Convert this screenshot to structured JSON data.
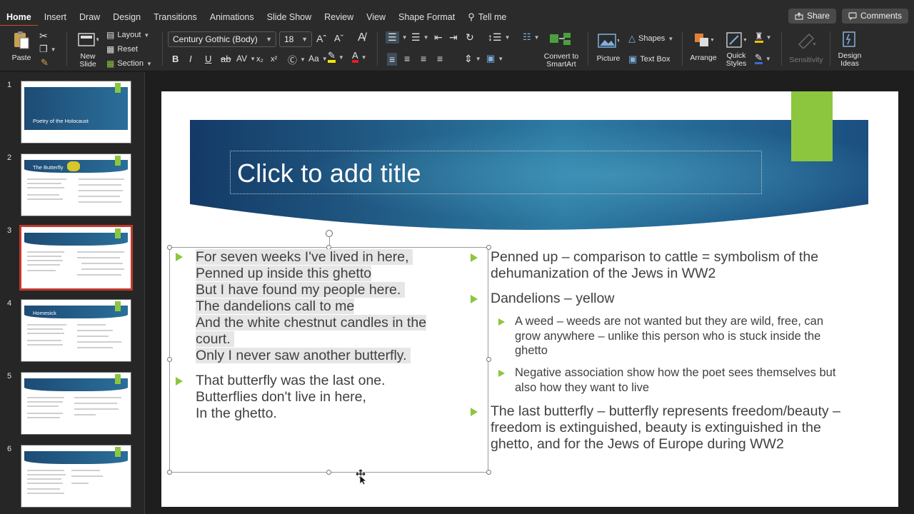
{
  "tabs": [
    "Home",
    "Insert",
    "Draw",
    "Design",
    "Transitions",
    "Animations",
    "Slide Show",
    "Review",
    "View",
    "Shape Format",
    "Tell me"
  ],
  "share_label": "Share",
  "comments_label": "Comments",
  "ribbon": {
    "paste": "Paste",
    "new_slide": [
      "New",
      "Slide"
    ],
    "layout": "Layout",
    "reset": "Reset",
    "section": "Section",
    "font_name": "Century Gothic (Body)",
    "font_size": "18",
    "convert": [
      "Convert to",
      "SmartArt"
    ],
    "picture": "Picture",
    "shapes": "Shapes",
    "text_box": "Text Box",
    "arrange": "Arrange",
    "quick_styles": [
      "Quick",
      "Styles"
    ],
    "sensitivity": "Sensitivity",
    "design_ideas": [
      "Design",
      "Ideas"
    ]
  },
  "thumbnails": [
    {
      "num": "1",
      "title": "Poetry of the Holocaust"
    },
    {
      "num": "2",
      "title": "The Butterfly"
    },
    {
      "num": "3",
      "title": ""
    },
    {
      "num": "4",
      "title": "Homesick"
    },
    {
      "num": "5",
      "title": ""
    },
    {
      "num": "6",
      "title": ""
    }
  ],
  "slide": {
    "title_placeholder": "Click to add title",
    "poem_stanza1": [
      "For seven weeks I've lived in here, ",
      "Penned up inside this ghetto",
      "But I have found my people here. ",
      "The dandelions call to me",
      "And the white chestnut candles in the",
      "court. ",
      "Only I never saw another butterfly. "
    ],
    "poem_stanza2": [
      "That butterfly was the last one.",
      "Butterflies don't live in here,",
      "In the ghetto."
    ],
    "analysis": {
      "point1": [
        "Penned up – comparison to cattle = symbolism of the",
        "dehumanization of the Jews in WW2"
      ],
      "point2": [
        "Dandelions – yellow"
      ],
      "sub1": [
        "A weed – weeds are not wanted but they are wild, free, can",
        "grow anywhere – unlike this person who is stuck inside the",
        "ghetto"
      ],
      "sub2": [
        "Negative association show how the poet sees themselves but",
        "also how they want to live"
      ],
      "point3": [
        "The last butterfly – butterfly represents freedom/beauty –",
        "freedom is extinguished, beauty is extinguished in the",
        "ghetto, and for the Jews of Europe during WW2"
      ]
    }
  },
  "colors": {
    "accent_green": "#8cc63f",
    "selection_red": "#c0392b",
    "banner_blue": "#1d4b74"
  }
}
